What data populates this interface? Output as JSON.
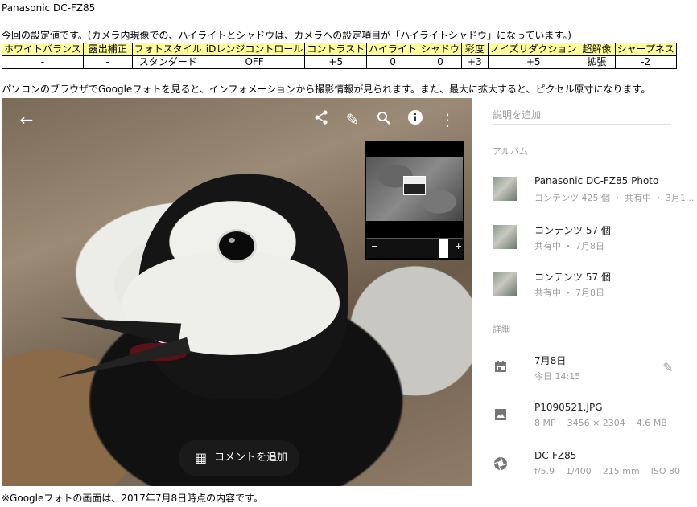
{
  "header": {
    "title": "Panasonic DC-FZ85",
    "intro": "今回の設定値です。(カメラ内現像での、ハイライトとシャドウは、カメラへの設定項目が「ハイライトシャドウ」になっています。)"
  },
  "settings_table": {
    "headers": [
      "ホワイトバランス",
      "露出補正",
      "フォトスタイル",
      "iDレンジコントロール",
      "コントラスト",
      "ハイライト",
      "シャドウ",
      "彩度",
      "ノイズリダクション",
      "超解像",
      "シャープネス"
    ],
    "values": [
      "-",
      "-",
      "スタンダード",
      "OFF",
      "+5",
      "0",
      "0",
      "+3",
      "+5",
      "拡張",
      "-2"
    ]
  },
  "caption": "パソコンのブラウザでGoogleフォトを見ると、インフォメーションから撮影情報が見られます。また、最大に拡大すると、ピクセル原寸になります。",
  "viewer": {
    "icons": [
      "back-arrow-icon",
      "share-icon",
      "edit-icon",
      "zoom-icon",
      "info-icon",
      "more-icon"
    ],
    "zoom_minus": "−",
    "zoom_plus": "+",
    "comment_label": "コメントを追加"
  },
  "info_panel": {
    "description_placeholder": "説明を追加",
    "album_heading": "アルバム",
    "albums": [
      {
        "title": "Panasonic DC-FZ85 Photo",
        "meta": "コンテンツ 425 個 ・ 共有中 ・ 3月1..."
      },
      {
        "title": "コンテンツ 57 個",
        "meta": "共有中 ・ 7月8日"
      },
      {
        "title": "コンテンツ 57 個",
        "meta": "共有中 ・ 7月8日"
      }
    ],
    "details_heading": "詳細",
    "date": {
      "main": "7月8日",
      "sub": "今日 14:15"
    },
    "file": {
      "main": "P1090521.JPG",
      "sub": "8 MP    3456 × 2304    4.6 MB"
    },
    "camera": {
      "main": "DC-FZ85",
      "sub": "f/5.9    1/400    215 mm    ISO 80"
    }
  },
  "footer": "※Googleフォトの画面は、2017年7月8日時点の内容です。"
}
